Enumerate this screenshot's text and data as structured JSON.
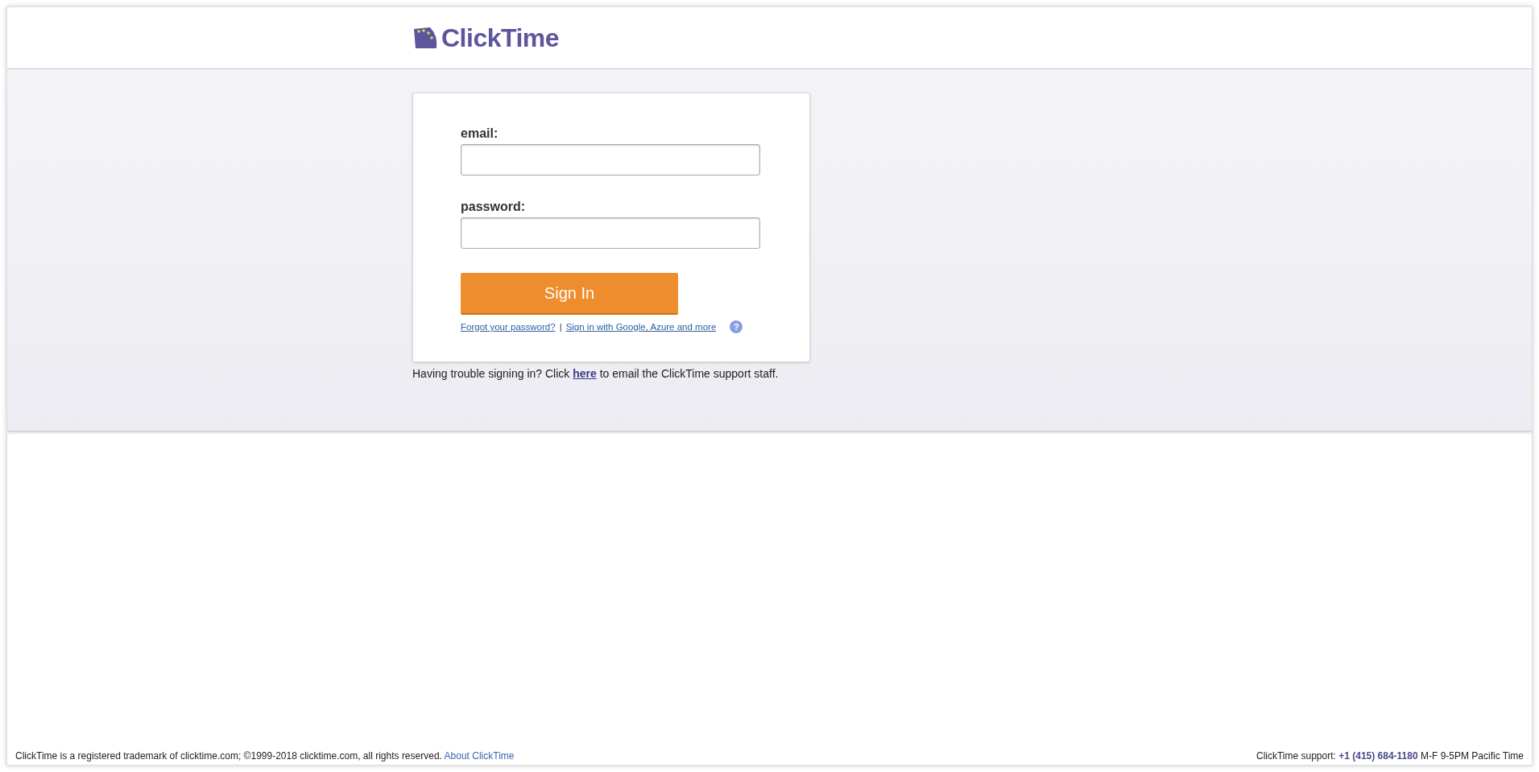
{
  "header": {
    "logo_text": "ClickTime"
  },
  "login_form": {
    "email_label": "email:",
    "password_label": "password:",
    "sign_in_button": "Sign In",
    "forgot_link": "Forgot your password?",
    "separator": "|",
    "sso_link": "Sign in with Google, Azure and more",
    "help_icon": "?"
  },
  "trouble_note": {
    "before": "Having trouble signing in? Click ",
    "link": "here",
    "after": " to email the ClickTime support staff."
  },
  "footer": {
    "legal": "ClickTime is a registered trademark of clicktime.com; ©1999-2018 clicktime.com, all rights reserved.",
    "about_link": "About ClickTime",
    "support_before": "ClickTime support: ",
    "support_phone": "+1 (415) 684-1180",
    "support_after": " M-F 9-5PM Pacific Time"
  }
}
